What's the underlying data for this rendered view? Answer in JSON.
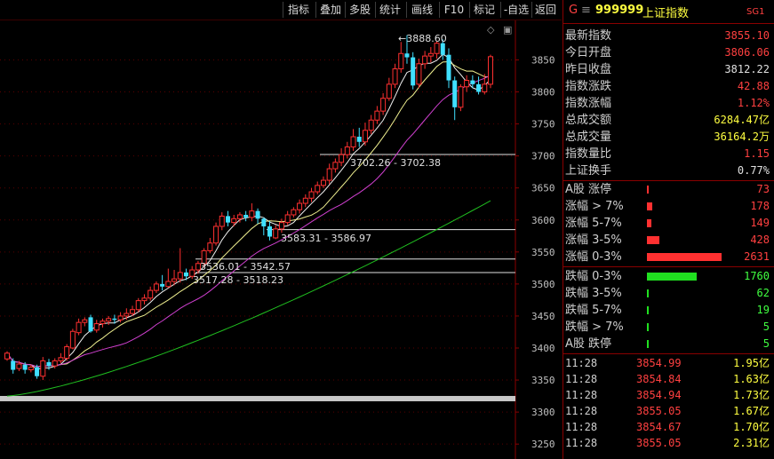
{
  "toolbar": {
    "buttons": [
      "指标",
      "叠加",
      "多股",
      "统计",
      "画线",
      "F10",
      "标记",
      "-自选",
      "返回"
    ]
  },
  "chart_data": {
    "type": "candlestick",
    "ylim": [
      3235,
      3895
    ],
    "yticks": [
      3850,
      3800,
      3750,
      3700,
      3650,
      3600,
      3550,
      3500,
      3450,
      3400,
      3350,
      3300,
      3250
    ],
    "annotations": [
      "3888.60",
      "3702.26 - 3702.38",
      "3583.31 - 3586.97",
      "3536.01 - 3542.57",
      "3517.28 - 3518.23"
    ],
    "hlines": [
      3702.3,
      3585,
      3539,
      3517.8
    ],
    "thick_hline": 3321,
    "candles": [
      [
        3383,
        3392,
        3380,
        3395
      ],
      [
        3380,
        3366,
        3360,
        3384
      ],
      [
        3368,
        3375,
        3364,
        3380
      ],
      [
        3374,
        3366,
        3360,
        3378
      ],
      [
        3366,
        3370,
        3362,
        3374
      ],
      [
        3370,
        3356,
        3352,
        3374
      ],
      [
        3356,
        3380,
        3350,
        3386
      ],
      [
        3378,
        3372,
        3366,
        3383
      ],
      [
        3372,
        3380,
        3368,
        3384
      ],
      [
        3380,
        3385,
        3376,
        3392
      ],
      [
        3384,
        3402,
        3380,
        3406
      ],
      [
        3400,
        3426,
        3398,
        3430
      ],
      [
        3424,
        3440,
        3420,
        3446
      ],
      [
        3440,
        3444,
        3434,
        3448
      ],
      [
        3448,
        3426,
        3424,
        3452
      ],
      [
        3428,
        3438,
        3424,
        3444
      ],
      [
        3438,
        3442,
        3432,
        3446
      ],
      [
        3442,
        3446,
        3436,
        3450
      ],
      [
        3446,
        3444,
        3438,
        3452
      ],
      [
        3444,
        3450,
        3440,
        3456
      ],
      [
        3450,
        3454,
        3444,
        3462
      ],
      [
        3454,
        3460,
        3450,
        3466
      ],
      [
        3460,
        3474,
        3456,
        3478
      ],
      [
        3474,
        3478,
        3468,
        3484
      ],
      [
        3478,
        3490,
        3474,
        3496
      ],
      [
        3490,
        3500,
        3486,
        3504
      ],
      [
        3500,
        3496,
        3490,
        3514
      ],
      [
        3496,
        3504,
        3494,
        3524
      ],
      [
        3504,
        3508,
        3498,
        3522
      ],
      [
        3508,
        3518,
        3502,
        3556
      ],
      [
        3518,
        3512,
        3506,
        3524
      ],
      [
        3512,
        3522,
        3508,
        3528
      ],
      [
        3522,
        3532,
        3516,
        3536
      ],
      [
        3532,
        3552,
        3526,
        3556
      ],
      [
        3552,
        3564,
        3548,
        3572
      ],
      [
        3564,
        3590,
        3560,
        3596
      ],
      [
        3590,
        3606,
        3584,
        3612
      ],
      [
        3606,
        3596,
        3590,
        3614
      ],
      [
        3596,
        3602,
        3590,
        3608
      ],
      [
        3602,
        3608,
        3596,
        3612
      ],
      [
        3608,
        3604,
        3598,
        3614
      ],
      [
        3604,
        3614,
        3598,
        3626
      ],
      [
        3614,
        3602,
        3594,
        3618
      ],
      [
        3602,
        3590,
        3576,
        3604
      ],
      [
        3590,
        3574,
        3568,
        3598
      ],
      [
        3572,
        3586,
        3570,
        3592
      ],
      [
        3586,
        3596,
        3580,
        3602
      ],
      [
        3596,
        3608,
        3592,
        3614
      ],
      [
        3608,
        3616,
        3604,
        3620
      ],
      [
        3616,
        3626,
        3610,
        3632
      ],
      [
        3626,
        3634,
        3620,
        3640
      ],
      [
        3634,
        3644,
        3628,
        3650
      ],
      [
        3644,
        3654,
        3640,
        3660
      ],
      [
        3654,
        3662,
        3650,
        3668
      ],
      [
        3662,
        3680,
        3656,
        3688
      ],
      [
        3680,
        3690,
        3674,
        3696
      ],
      [
        3690,
        3702,
        3684,
        3712
      ],
      [
        3702,
        3714,
        3696,
        3722
      ],
      [
        3714,
        3730,
        3708,
        3742
      ],
      [
        3730,
        3722,
        3714,
        3744
      ],
      [
        3722,
        3740,
        3716,
        3752
      ],
      [
        3740,
        3756,
        3734,
        3764
      ],
      [
        3756,
        3770,
        3750,
        3778
      ],
      [
        3770,
        3790,
        3764,
        3798
      ],
      [
        3790,
        3812,
        3786,
        3822
      ],
      [
        3812,
        3836,
        3806,
        3844
      ],
      [
        3836,
        3860,
        3830,
        3878
      ],
      [
        3860,
        3854,
        3844,
        3888.6
      ],
      [
        3854,
        3810,
        3804,
        3862
      ],
      [
        3812,
        3844,
        3806,
        3852
      ],
      [
        3844,
        3856,
        3836,
        3864
      ],
      [
        3856,
        3860,
        3846,
        3870
      ],
      [
        3860,
        3876,
        3852,
        3880
      ],
      [
        3876,
        3858,
        3850,
        3882
      ],
      [
        3858,
        3818,
        3806,
        3868
      ],
      [
        3818,
        3776,
        3756,
        3824
      ],
      [
        3776,
        3808,
        3770,
        3812
      ],
      [
        3808,
        3818,
        3800,
        3826
      ],
      [
        3818,
        3812,
        3806,
        3826
      ],
      [
        3812,
        3800,
        3796,
        3824
      ],
      [
        3800,
        3812,
        3796,
        3828
      ],
      [
        3812,
        3855,
        3806,
        3858
      ]
    ]
  },
  "panel": {
    "code_prefix": "G",
    "code": "999999",
    "name": "上证指数",
    "tag": "SG1",
    "stats": [
      {
        "k": "最新指数",
        "v": "3855.10",
        "c": "#ff4040"
      },
      {
        "k": "今日开盘",
        "v": "3806.06",
        "c": "#ff4040"
      },
      {
        "k": "昨日收盘",
        "v": "3812.22",
        "c": "#e0e0e0"
      },
      {
        "k": "指数涨跌",
        "v": "42.88",
        "c": "#ff4040"
      },
      {
        "k": "指数涨幅",
        "v": "1.12%",
        "c": "#ff4040"
      },
      {
        "k": "总成交额",
        "v": "6284.47亿",
        "c": "#ffff40"
      },
      {
        "k": "总成交量",
        "v": "36164.2万",
        "c": "#ffff40"
      },
      {
        "k": "指数量比",
        "v": "1.15",
        "c": "#ff4040"
      },
      {
        "k": "上证换手",
        "v": "0.77%",
        "c": "#e0e0e0"
      }
    ],
    "dist": [
      {
        "k": "A股 涨停",
        "v": "73",
        "c": "#ff4040",
        "n": 73
      },
      {
        "k": "涨幅 > 7%",
        "v": "178",
        "c": "#ff4040",
        "n": 178
      },
      {
        "k": "涨幅 5-7%",
        "v": "149",
        "c": "#ff4040",
        "n": 149
      },
      {
        "k": "涨幅 3-5%",
        "v": "428",
        "c": "#ff4040",
        "n": 428
      },
      {
        "k": "涨幅 0-3%",
        "v": "2631",
        "c": "#ff4040",
        "n": 2631
      },
      {
        "k": "跌幅 0-3%",
        "v": "1760",
        "c": "#40ff40",
        "n": 1760
      },
      {
        "k": "跌幅 3-5%",
        "v": "62",
        "c": "#40ff40",
        "n": 62
      },
      {
        "k": "跌幅 5-7%",
        "v": "19",
        "c": "#40ff40",
        "n": 19
      },
      {
        "k": "跌幅 > 7%",
        "v": "5",
        "c": "#40ff40",
        "n": 5
      },
      {
        "k": "A股 跌停",
        "v": "5",
        "c": "#40ff40",
        "n": 5
      }
    ],
    "ticks": [
      {
        "t": "11:28",
        "p": "3854.99",
        "a": "1.95亿"
      },
      {
        "t": "11:28",
        "p": "3854.84",
        "a": "1.63亿"
      },
      {
        "t": "11:28",
        "p": "3854.94",
        "a": "1.73亿"
      },
      {
        "t": "11:28",
        "p": "3855.05",
        "a": "1.67亿"
      },
      {
        "t": "11:28",
        "p": "3854.67",
        "a": "1.70亿"
      },
      {
        "t": "11:28",
        "p": "3855.05",
        "a": "2.31亿"
      }
    ]
  }
}
